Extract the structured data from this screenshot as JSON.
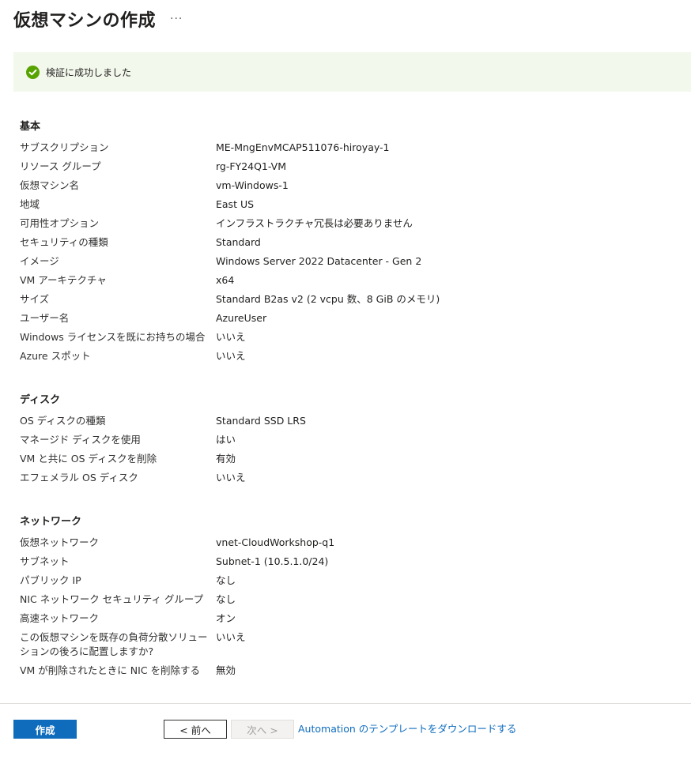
{
  "header": {
    "title": "仮想マシンの作成",
    "more_label": "···"
  },
  "banner": {
    "icon": "success-check-icon",
    "text": "検証に成功しました",
    "color": "#57a300"
  },
  "sections": {
    "basics": {
      "title": "基本",
      "rows": [
        {
          "label": "サブスクリプション",
          "value": "ME-MngEnvMCAP511076-hiroyay-1"
        },
        {
          "label": "リソース グループ",
          "value": "rg-FY24Q1-VM"
        },
        {
          "label": "仮想マシン名",
          "value": "vm-Windows-1"
        },
        {
          "label": "地域",
          "value": "East US"
        },
        {
          "label": "可用性オプション",
          "value": "インフラストラクチャ冗長は必要ありません"
        },
        {
          "label": "セキュリティの種類",
          "value": "Standard"
        },
        {
          "label": "イメージ",
          "value": "Windows Server 2022 Datacenter - Gen 2"
        },
        {
          "label": "VM アーキテクチャ",
          "value": "x64"
        },
        {
          "label": "サイズ",
          "value": "Standard B2as v2 (2 vcpu 数、8 GiB のメモリ)"
        },
        {
          "label": "ユーザー名",
          "value": "AzureUser"
        },
        {
          "label": "Windows ライセンスを既にお持ちの場合",
          "value": "いいえ"
        },
        {
          "label": "Azure スポット",
          "value": "いいえ"
        }
      ]
    },
    "disks": {
      "title": "ディスク",
      "rows": [
        {
          "label": "OS ディスクの種類",
          "value": "Standard SSD LRS"
        },
        {
          "label": "マネージド ディスクを使用",
          "value": "はい"
        },
        {
          "label": "VM と共に OS ディスクを削除",
          "value": "有効"
        },
        {
          "label": "エフェメラル OS ディスク",
          "value": "いいえ"
        }
      ]
    },
    "network": {
      "title": "ネットワーク",
      "rows": [
        {
          "label": "仮想ネットワーク",
          "value": "vnet-CloudWorkshop-q1"
        },
        {
          "label": "サブネット",
          "value": "Subnet-1 (10.5.1.0/24)"
        },
        {
          "label": "パブリック IP",
          "value": "なし"
        },
        {
          "label": "NIC ネットワーク セキュリティ グループ",
          "value": "なし"
        },
        {
          "label": "高速ネットワーク",
          "value": "オン"
        },
        {
          "label": "この仮想マシンを既存の負荷分散ソリューションの後ろに配置しますか?",
          "value": "いいえ"
        },
        {
          "label": "VM が削除されたときに NIC を削除する",
          "value": "無効"
        }
      ]
    }
  },
  "footer": {
    "create_label": "作成",
    "prev_label": "< 前へ",
    "next_label": "次へ >",
    "template_link": "Automation のテンプレートをダウンロードする",
    "accent_color": "#0f6cbd"
  }
}
